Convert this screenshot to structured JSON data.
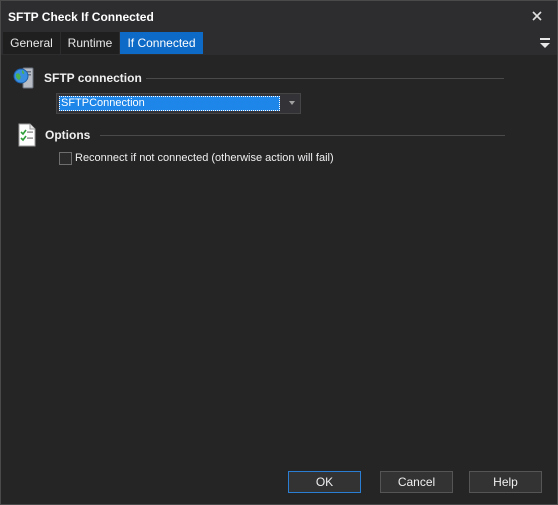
{
  "window": {
    "title": "SFTP Check If Connected"
  },
  "tabs": [
    {
      "label": "General"
    },
    {
      "label": "Runtime"
    },
    {
      "label": "If Connected",
      "active": true
    }
  ],
  "sections": {
    "connection": {
      "title": "SFTP connection",
      "selected_value": "SFTPConnection"
    },
    "options": {
      "title": "Options",
      "reconnect_label": "Reconnect if not connected (otherwise action will fail)",
      "reconnect_checked": false
    }
  },
  "buttons": {
    "ok": "OK",
    "cancel": "Cancel",
    "help": "Help"
  },
  "icons": {
    "close": "close-icon",
    "tab_menu": "hamburger-menu-icon",
    "connection": "server-globe-icon",
    "options": "checklist-icon",
    "dropdown": "chevron-down-icon"
  },
  "colors": {
    "accent": "#0e6ac7",
    "selection": "#1e86e8",
    "background": "#252526"
  }
}
